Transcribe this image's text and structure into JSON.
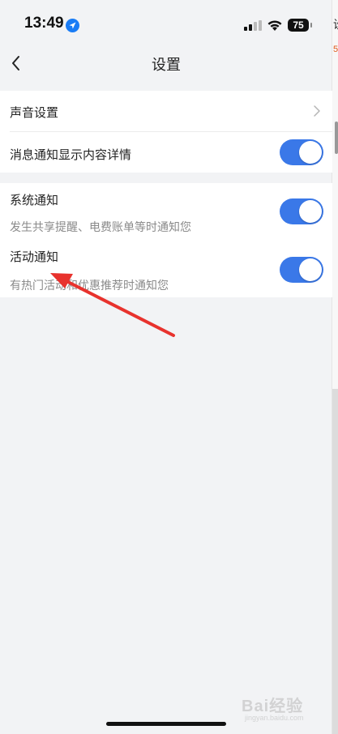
{
  "status_bar": {
    "time": "13:49",
    "battery": "75",
    "location_icon": "location-arrow-icon",
    "signal_icon": "cellular-signal-icon",
    "wifi_icon": "wifi-icon"
  },
  "nav": {
    "title": "设置",
    "back_icon": "chevron-left-icon"
  },
  "group1": {
    "rows": [
      {
        "label": "声音设置",
        "control": "chevron"
      },
      {
        "label": "消息通知显示内容详情",
        "control": "toggle",
        "on": true
      }
    ]
  },
  "group2": {
    "rows": [
      {
        "label": "系统通知",
        "description": "发生共享提醒、电费账单等时通知您",
        "control": "toggle",
        "on": true
      },
      {
        "label": "活动通知",
        "description": "有热门活动和优惠推荐时通知您",
        "control": "toggle",
        "on": true
      }
    ]
  },
  "edge": {
    "char1": "设",
    "char2": "5"
  },
  "watermark": {
    "main": "Bai经验",
    "sub": "jingyan.baidu.com"
  },
  "colors": {
    "accent": "#3a78e8",
    "background": "#f2f3f5",
    "annotation": "#e8322d",
    "location": "#1a7cf5"
  }
}
